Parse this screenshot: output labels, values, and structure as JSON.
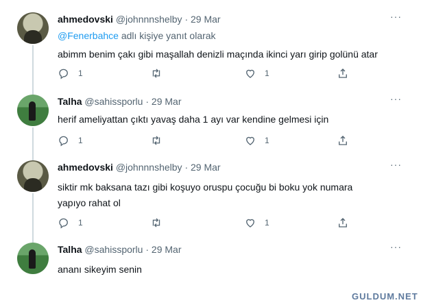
{
  "tweets": [
    {
      "name": "ahmedovski",
      "handle": "@johnnnshelby",
      "dot": "·",
      "date": "29 Mar",
      "more": "···",
      "reply_prefix": "@Fenerbahce",
      "reply_suffix": " adlı kişiye yanıt olarak",
      "text": "abimm benim çakı gibi maşallah denizli maçında ikinci yarı girip golünü atar",
      "replies": "1",
      "retweets": "",
      "likes": "1"
    },
    {
      "name": "Talha",
      "handle": "@sahissporlu",
      "dot": "·",
      "date": "29 Mar",
      "more": "···",
      "text": "herif ameliyattan çıktı yavaş daha 1 ayı var kendine gelmesi için",
      "replies": "1",
      "retweets": "",
      "likes": "1"
    },
    {
      "name": "ahmedovski",
      "handle": "@johnnnshelby",
      "dot": "·",
      "date": "29 Mar",
      "more": "···",
      "text_line1": "siktir mk baksana tazı gibi koşuyo oruspu çocuğu bi boku yok numara",
      "text_line2": "yapıyo rahat ol",
      "replies": "1",
      "retweets": "",
      "likes": "1"
    },
    {
      "name": "Talha",
      "handle": "@sahissporlu",
      "dot": "·",
      "date": "29 Mar",
      "more": "···",
      "text": "ananı sikeyim senin"
    }
  ],
  "icons": [
    "reply-icon",
    "retweet-icon",
    "like-icon",
    "share-icon"
  ],
  "colors": {
    "link": "#1d9bf0",
    "muted": "#536471",
    "thread_line": "#cfd9de"
  },
  "watermark": "GULDUM.NET"
}
